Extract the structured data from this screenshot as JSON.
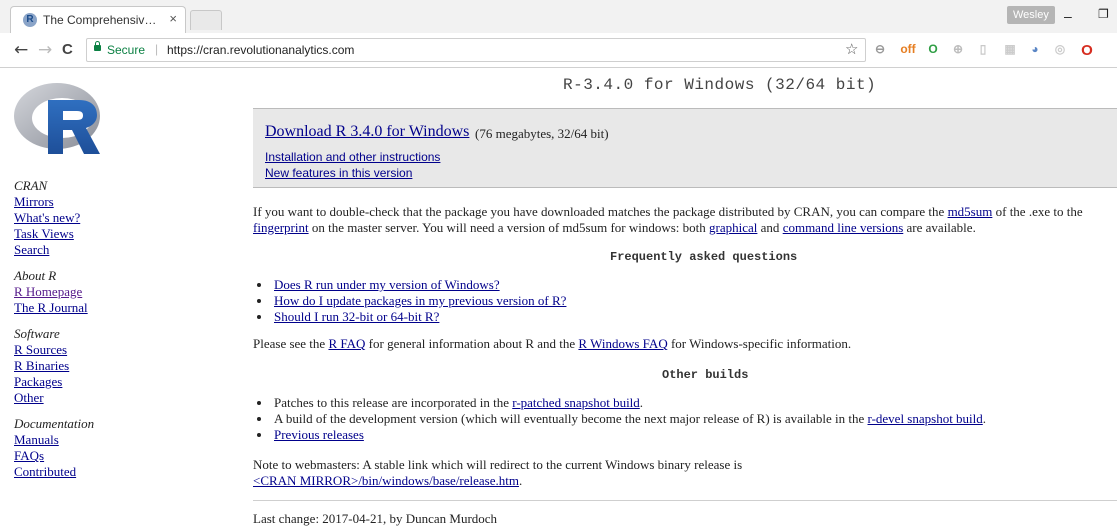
{
  "browser": {
    "tab_title": "The Comprehensive R Ar",
    "tab_close": "×",
    "profile_name": "Wesley",
    "window_min": "–",
    "window_max": "❐",
    "nav_back": "←",
    "nav_forward": "→",
    "nav_reload": "C",
    "secure_label": "Secure",
    "url_separator": "|",
    "url": "https://cran.revolutionanalytics.com",
    "bookmark_star": "☆",
    "accent_secure": "#0b8043",
    "extensions": [
      {
        "name": "minus-extension-icon",
        "label": "⊖",
        "color": "#9a9a9a"
      },
      {
        "name": "off-extension-icon",
        "label": "off",
        "color": "#e67e22"
      },
      {
        "name": "green-extension-icon",
        "label": "O",
        "color": "#2e9e44"
      },
      {
        "name": "gray-extension-icon",
        "label": "⊕",
        "color": "#bdbdbd"
      },
      {
        "name": "page-extension-icon",
        "label": "▯",
        "color": "#c9c9c9"
      },
      {
        "name": "grid-extension-icon",
        "label": "▦",
        "color": "#cccccc"
      },
      {
        "name": "rss-extension-icon",
        "label": "◕",
        "color": "#5b86c5"
      },
      {
        "name": "circle-extension-icon",
        "label": "◎",
        "color": "#cccccc"
      },
      {
        "name": "opera-icon",
        "label": "O",
        "color": "#d62d20"
      }
    ]
  },
  "sidebar": {
    "groups": [
      {
        "heading": "CRAN",
        "links": [
          "Mirrors",
          "What's new?",
          "Task Views",
          "Search"
        ]
      },
      {
        "heading": "About R",
        "links": [
          "R Homepage",
          "The R Journal"
        ]
      },
      {
        "heading": "Software",
        "links": [
          "R Sources",
          "R Binaries",
          "Packages",
          "Other"
        ]
      },
      {
        "heading": "Documentation",
        "links": [
          "Manuals",
          "FAQs",
          "Contributed"
        ]
      }
    ]
  },
  "main": {
    "title": "R-3.4.0 for Windows (32/64 bit)",
    "download_link": "Download R 3.4.0 for Windows",
    "download_size": "(76 megabytes, 32/64 bit)",
    "install_link": "Installation and other instructions",
    "newfeatures_link": "New features in this version",
    "md5_text1": "If you want to double-check that the package you have downloaded matches the package distributed by CRAN, you can compare the ",
    "md5_link": "md5sum",
    "md5_text2": " of the .exe to the",
    "fingerprint_link": "fingerprint",
    "md5_text3": " on the master server. You will need a version of md5sum for windows: both ",
    "graphical_link": "graphical",
    "md5_text4": " and ",
    "cmdline_link": "command line versions",
    "md5_text5": " are available.",
    "faq_heading": "Frequently asked questions",
    "faq_items": [
      "Does R run under my version of Windows?",
      "How do I update packages in my previous version of R?",
      "Should I run 32-bit or 64-bit R?"
    ],
    "rfaq_text1": "Please see the ",
    "rfaq_link": "R FAQ",
    "rfaq_text2": " for general information about R and the ",
    "rwinfaq_link": "R Windows FAQ",
    "rfaq_text3": " for Windows-specific information.",
    "other_heading": "Other builds",
    "patch_text": "Patches to this release are incorporated in the ",
    "patch_link": "r-patched snapshot build",
    "patch_end": ".",
    "devel_text": "A build of the development version (which will eventually become the next major release of R) is available in the ",
    "devel_link": "r-devel snapshot build",
    "devel_end": ".",
    "previous_link": "Previous releases",
    "webmaster_text": "Note to webmasters: A stable link which will redirect to the current Windows binary release is",
    "release_link": "<CRAN MIRROR>/bin/windows/base/release.htm",
    "release_end": ".",
    "last_change": "Last change: 2017-04-21, by Duncan Murdoch"
  }
}
